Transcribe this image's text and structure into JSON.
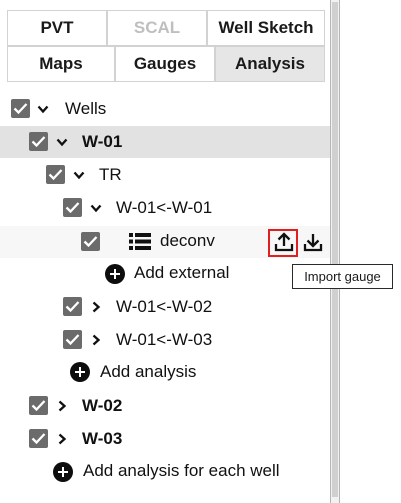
{
  "tabs": {
    "row1": [
      {
        "label": "PVT",
        "state": "normal"
      },
      {
        "label": "SCAL",
        "state": "disabled"
      },
      {
        "label": "Well Sketch",
        "state": "normal"
      }
    ],
    "row2": [
      {
        "label": "Maps",
        "state": "normal"
      },
      {
        "label": "Gauges",
        "state": "normal"
      },
      {
        "label": "Analysis",
        "state": "active"
      }
    ]
  },
  "tree": {
    "wells": {
      "label": "Wells",
      "checked": true,
      "expanded": true
    },
    "w01": {
      "label": "W-01",
      "checked": true,
      "expanded": true,
      "selected": true
    },
    "tr": {
      "label": "TR",
      "checked": true,
      "expanded": true
    },
    "analysis_1": {
      "label": "W-01<-W-01",
      "checked": true,
      "expanded": true
    },
    "deconv": {
      "label": "deconv",
      "checked": true,
      "icon": "list-icon",
      "actions": [
        "upload-icon",
        "download-icon"
      ]
    },
    "add_external": {
      "label": "Add external"
    },
    "analysis_2": {
      "label": "W-01<-W-02",
      "checked": true,
      "expanded": false
    },
    "analysis_3": {
      "label": "W-01<-W-03",
      "checked": true,
      "expanded": false
    },
    "add_analysis": {
      "label": "Add analysis"
    },
    "w02": {
      "label": "W-02",
      "checked": true,
      "expanded": false
    },
    "w03": {
      "label": "W-03",
      "checked": true,
      "expanded": false
    },
    "add_analysis_each": {
      "label": "Add analysis for each well"
    }
  },
  "tooltip": {
    "text": "Import gauge"
  },
  "colors": {
    "checkbox": "#6b6b6b",
    "selected_row": "#e2e2e2",
    "active_tab": "#e6e6e6",
    "highlight_border": "#e02020"
  }
}
